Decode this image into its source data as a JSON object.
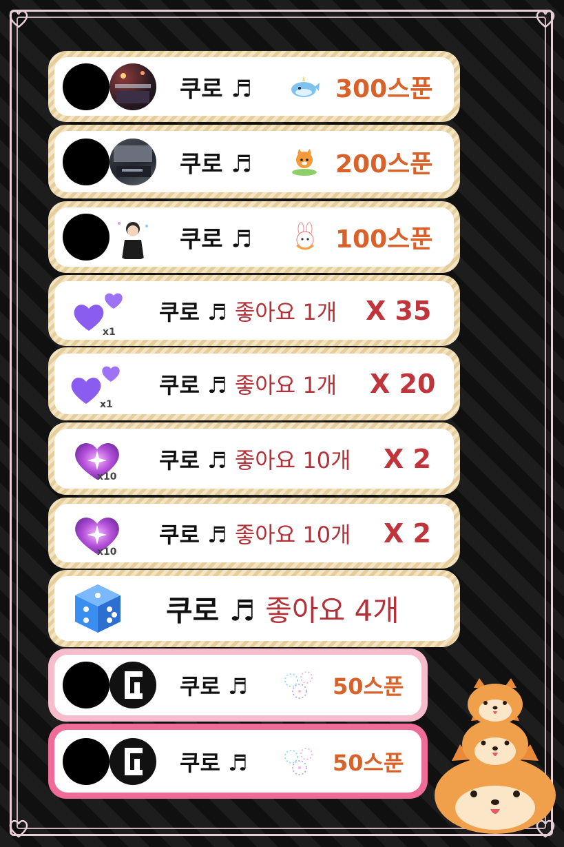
{
  "rows": [
    {
      "name": "쿠로",
      "note": "♬",
      "amount": "300스푼",
      "sticker": "whale-sticker-icon"
    },
    {
      "name": "쿠로",
      "note": "♬",
      "amount": "200스푼",
      "sticker": "tiger-sticker-icon"
    },
    {
      "name": "쿠로",
      "note": "♬",
      "amount": "100스푼",
      "sticker": "bunny-sticker-icon"
    },
    {
      "name": "쿠로",
      "note": "♬",
      "likes": "좋아요 1개",
      "multiplier": "X 35",
      "gift_count": "x1",
      "gift": "purple-hearts-icon"
    },
    {
      "name": "쿠로",
      "note": "♬",
      "likes": "좋아요 1개",
      "multiplier": "X 20",
      "gift_count": "x1",
      "gift": "purple-hearts-icon"
    },
    {
      "name": "쿠로",
      "note": "♬",
      "likes": "좋아요 10개",
      "multiplier": "X 2",
      "gift_count": "x10",
      "gift": "sparkle-heart-icon"
    },
    {
      "name": "쿠로",
      "note": "♬",
      "likes": "좋아요 10개",
      "multiplier": "X 2",
      "gift_count": "x10",
      "gift": "sparkle-heart-icon"
    },
    {
      "name": "쿠로",
      "note": "♬",
      "likes": "좋아요 4개",
      "gift": "dice-icon"
    },
    {
      "name": "쿠로",
      "note": "♬",
      "amount": "50스푼",
      "sticker": "fireworks-sticker-icon"
    },
    {
      "name": "쿠로",
      "note": "♬",
      "amount": "50스푼",
      "sticker": "fireworks-sticker-icon"
    }
  ],
  "colors": {
    "amount": "#d9622b",
    "multiplier": "#c0353c",
    "likes": "#b3323a",
    "frame": "#e6cfd6",
    "wood_border": "#e6cd9c",
    "pink_border": "#f6bccc",
    "pink_border_strong": "#ee6c97"
  },
  "decoration": "shiba-dog-stack-icon"
}
